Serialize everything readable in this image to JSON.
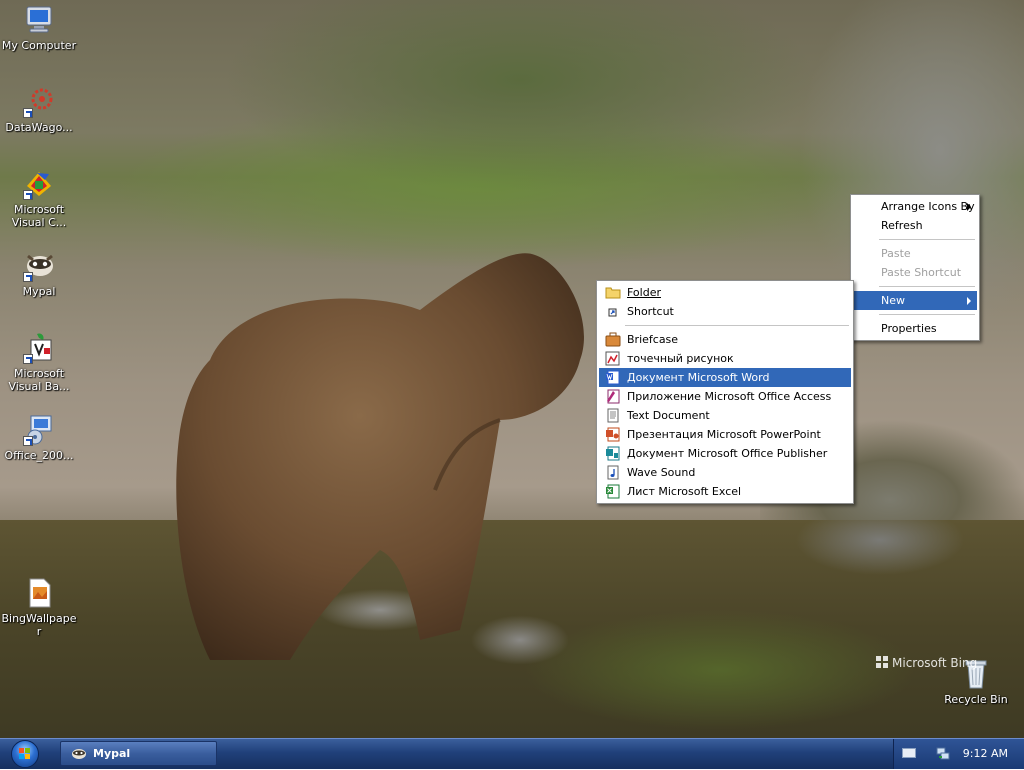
{
  "desktop_icons": [
    {
      "label": "My Computer",
      "icon": "computer-icon"
    },
    {
      "label": "DataWago...",
      "icon": "datawagon-icon"
    },
    {
      "label": "Microsoft Visual C...",
      "icon": "visual-c-icon"
    },
    {
      "label": "Mypal",
      "icon": "mypal-icon"
    },
    {
      "label": "Microsoft Visual Ba...",
      "icon": "visual-basic-icon"
    },
    {
      "label": "Office_200...",
      "icon": "office-setup-icon"
    },
    {
      "label": "BingWallpaper",
      "icon": "bing-wallpaper-icon"
    },
    {
      "label": "Recycle Bin",
      "icon": "recycle-bin-icon"
    }
  ],
  "context_menu": {
    "items": [
      {
        "label": "Arrange Icons By",
        "submenu": true
      },
      {
        "label": "Refresh"
      },
      {
        "label": "Paste",
        "disabled": true
      },
      {
        "label": "Paste Shortcut",
        "disabled": true
      },
      {
        "label": "New",
        "submenu": true,
        "highlighted": true
      },
      {
        "label": "Properties"
      }
    ]
  },
  "new_submenu": {
    "items": [
      {
        "label": "Folder",
        "icon": "folder-icon",
        "underline_first": true
      },
      {
        "label": "Shortcut",
        "icon": "shortcut-icon",
        "underline_first": true
      },
      {
        "label": "Briefcase",
        "icon": "briefcase-icon"
      },
      {
        "label": "точечный рисунок",
        "icon": "bitmap-icon"
      },
      {
        "label": "Документ Microsoft Word",
        "icon": "word-icon",
        "highlighted": true
      },
      {
        "label": "Приложение Microsoft Office Access",
        "icon": "access-icon"
      },
      {
        "label": "Text Document",
        "icon": "text-document-icon"
      },
      {
        "label": "Презентация Microsoft PowerPoint",
        "icon": "powerpoint-icon"
      },
      {
        "label": "Документ Microsoft Office Publisher",
        "icon": "publisher-icon"
      },
      {
        "label": "Wave Sound",
        "icon": "wave-sound-icon"
      },
      {
        "label": "Лист Microsoft Excel",
        "icon": "excel-icon"
      }
    ]
  },
  "taskbar": {
    "task_label": "Mypal",
    "clock": "9:12 AM"
  },
  "watermark": "Microsoft Bing",
  "colors": {
    "highlight": "#3168b8",
    "taskbar": "#20407a"
  }
}
